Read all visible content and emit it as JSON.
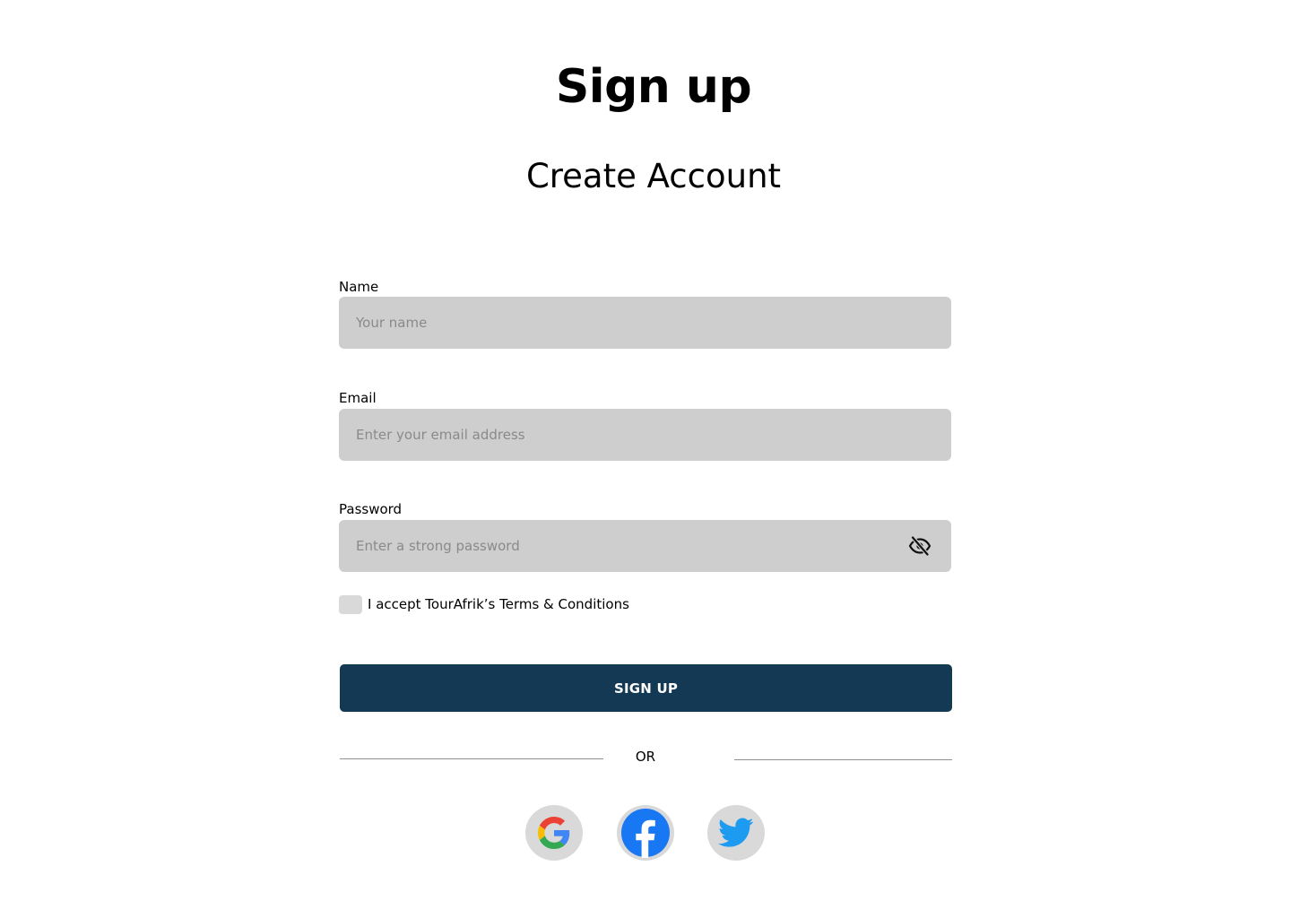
{
  "header": {
    "title": "Sign up",
    "subtitle": "Create Account"
  },
  "form": {
    "name": {
      "label": "Name",
      "placeholder": "Your name",
      "value": ""
    },
    "email": {
      "label": "Email",
      "placeholder": "Enter your email address",
      "value": ""
    },
    "password": {
      "label": "Password",
      "placeholder": "Enter a strong password",
      "value": "",
      "toggle_icon": "eye-slash-icon"
    },
    "terms": {
      "checked": false,
      "label": "I accept TourAfrik’s Terms & Conditions"
    },
    "submit_label": "SIGN UP"
  },
  "divider": {
    "label": "OR"
  },
  "social": [
    {
      "provider": "Google",
      "icon": "google-icon"
    },
    {
      "provider": "Facebook",
      "icon": "facebook-icon"
    },
    {
      "provider": "Twitter",
      "icon": "twitter-icon"
    }
  ],
  "colors": {
    "primary": "#133954",
    "input_background": "#cecece",
    "checkbox_background": "#d9d9d9",
    "social_background": "#d9d9d9",
    "facebook_blue": "#1877f2",
    "twitter_blue": "#1d9bf0"
  }
}
